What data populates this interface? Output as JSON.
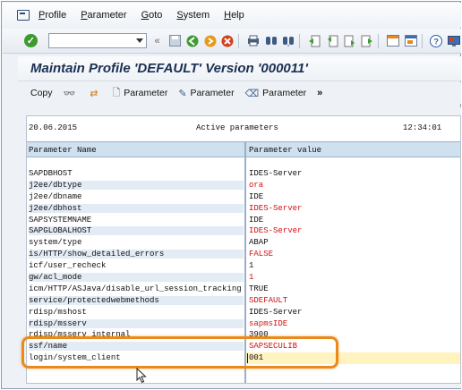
{
  "menu": {
    "items": [
      "Profile",
      "Parameter",
      "Goto",
      "System",
      "Help"
    ],
    "underline": [
      "P",
      "P",
      "G",
      "S",
      "H"
    ]
  },
  "toolbar": {
    "command_field_value": ""
  },
  "window": {
    "title": "Maintain Profile 'DEFAULT' Version '000011'"
  },
  "app_toolbar": {
    "copy_label": "Copy",
    "parameter_labels": [
      "Parameter",
      "Parameter",
      "Parameter"
    ]
  },
  "report": {
    "date": "20.06.2015",
    "heading": "Active parameters",
    "time": "12:34:01",
    "col_name": "Parameter Name",
    "col_value": "Parameter value",
    "rows": [
      {
        "name": "SAPDBHOST",
        "value": "IDES-Server",
        "red": false
      },
      {
        "name": "j2ee/dbtype",
        "value": "ora",
        "red": true
      },
      {
        "name": "j2ee/dbname",
        "value": "IDE",
        "red": false
      },
      {
        "name": "j2ee/dbhost",
        "value": "IDES-Server",
        "red": true
      },
      {
        "name": "SAPSYSTEMNAME",
        "value": "IDE",
        "red": false
      },
      {
        "name": "SAPGLOBALHOST",
        "value": "IDES-Server",
        "red": true
      },
      {
        "name": "system/type",
        "value": "ABAP",
        "red": false
      },
      {
        "name": "is/HTTP/show_detailed_errors",
        "value": "FALSE",
        "red": true
      },
      {
        "name": "icf/user_recheck",
        "value": "1",
        "red": false
      },
      {
        "name": "gw/acl_mode",
        "value": "1",
        "red": true
      },
      {
        "name": "icm/HTTP/ASJava/disable_url_session_tracking",
        "value": "TRUE",
        "red": false
      },
      {
        "name": "service/protectedwebmethods",
        "value": "SDEFAULT",
        "red": true
      },
      {
        "name": "rdisp/mshost",
        "value": "IDES-Server",
        "red": false
      },
      {
        "name": "rdisp/msserv",
        "value": "sapmsIDE",
        "red": true
      },
      {
        "name": "rdisp/msserv_internal",
        "value": "3900",
        "red": false
      },
      {
        "name": "ssf/name",
        "value": "SAPSECULIB",
        "red": true
      },
      {
        "name": "login/system_client",
        "value": "001",
        "red": false,
        "editing": true
      }
    ]
  },
  "colors": {
    "highlight": "#ea8a1a",
    "value_changed": "#d21010",
    "input_bg": "#fff3bf"
  }
}
